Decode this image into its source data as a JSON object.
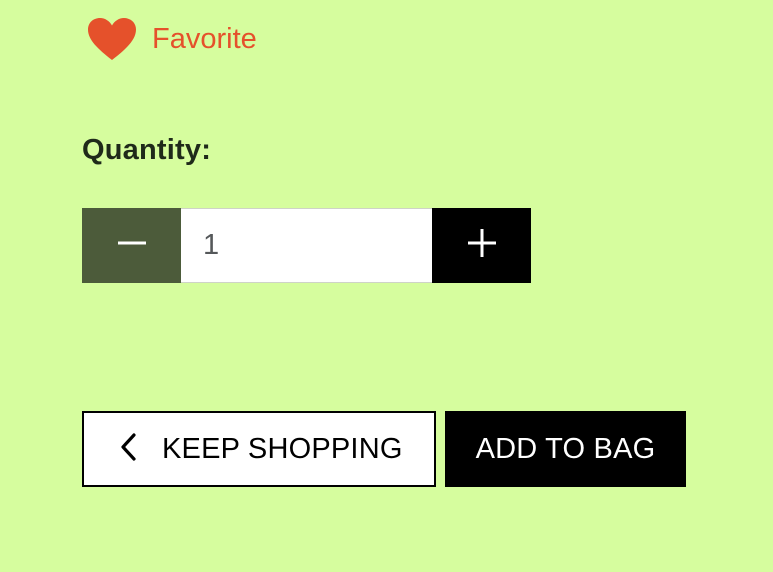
{
  "favorite": {
    "icon": "heart-icon",
    "label": "Favorite",
    "color": "#e5512b"
  },
  "quantity": {
    "label": "Quantity:",
    "value": "1",
    "decrement_icon": "minus-icon",
    "increment_icon": "plus-icon"
  },
  "actions": {
    "keep_shopping_icon": "chevron-left-icon",
    "keep_shopping_label": "KEEP SHOPPING",
    "add_to_bag_label": "ADD TO BAG"
  },
  "colors": {
    "background": "#d6fd9e",
    "decrement_button": "#4c5b3a",
    "increment_button": "#000000",
    "primary_button": "#000000"
  }
}
